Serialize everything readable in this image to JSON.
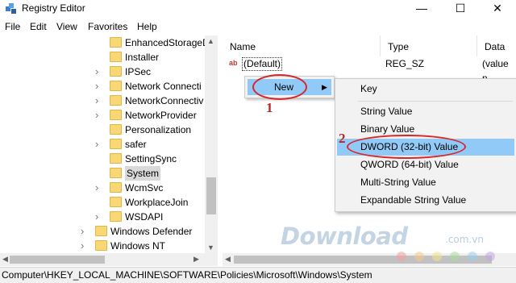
{
  "window": {
    "title": "Registry Editor",
    "minimize_glyph": "—",
    "maximize_glyph": "☐",
    "close_glyph": "✕"
  },
  "menu": {
    "items": [
      "File",
      "Edit",
      "View",
      "Favorites",
      "Help"
    ]
  },
  "tree": {
    "items": [
      {
        "label": "EnhancedStorageD",
        "expandable": false
      },
      {
        "label": "Installer",
        "expandable": false
      },
      {
        "label": "IPSec",
        "expandable": true
      },
      {
        "label": "Network Connecti",
        "expandable": true
      },
      {
        "label": "NetworkConnectiv",
        "expandable": true
      },
      {
        "label": "NetworkProvider",
        "expandable": true
      },
      {
        "label": "Personalization",
        "expandable": false
      },
      {
        "label": "safer",
        "expandable": true
      },
      {
        "label": "SettingSync",
        "expandable": false
      },
      {
        "label": "System",
        "expandable": false,
        "selected": true
      },
      {
        "label": "WcmSvc",
        "expandable": true
      },
      {
        "label": "WorkplaceJoin",
        "expandable": false
      },
      {
        "label": "WSDAPI",
        "expandable": true
      },
      {
        "label": "Windows Defender",
        "expandable": true
      },
      {
        "label": "Windows NT",
        "expandable": true
      }
    ]
  },
  "values": {
    "columns": {
      "name": "Name",
      "type": "Type",
      "data": "Data"
    },
    "rows": [
      {
        "icon": "ab",
        "name": "(Default)",
        "type": "REG_SZ",
        "data": "(value n"
      }
    ]
  },
  "context_menu": {
    "new_label": "New",
    "submenu": [
      "Key",
      "String Value",
      "Binary Value",
      "DWORD (32-bit) Value",
      "QWORD (64-bit) Value",
      "Multi-String Value",
      "Expandable String Value"
    ],
    "highlighted_index": 3
  },
  "annotations": {
    "step1": "1",
    "step2": "2",
    "color": "#d9262b"
  },
  "status": {
    "path": "Computer\\HKEY_LOCAL_MACHINE\\SOFTWARE\\Policies\\Microsoft\\Windows\\System"
  },
  "watermark": {
    "text": "Download",
    "suffix": ".com.vn"
  },
  "colors": {
    "highlight": "#91c9f7",
    "folder": "#f8d775",
    "menu_bg": "#f2f2f2"
  }
}
